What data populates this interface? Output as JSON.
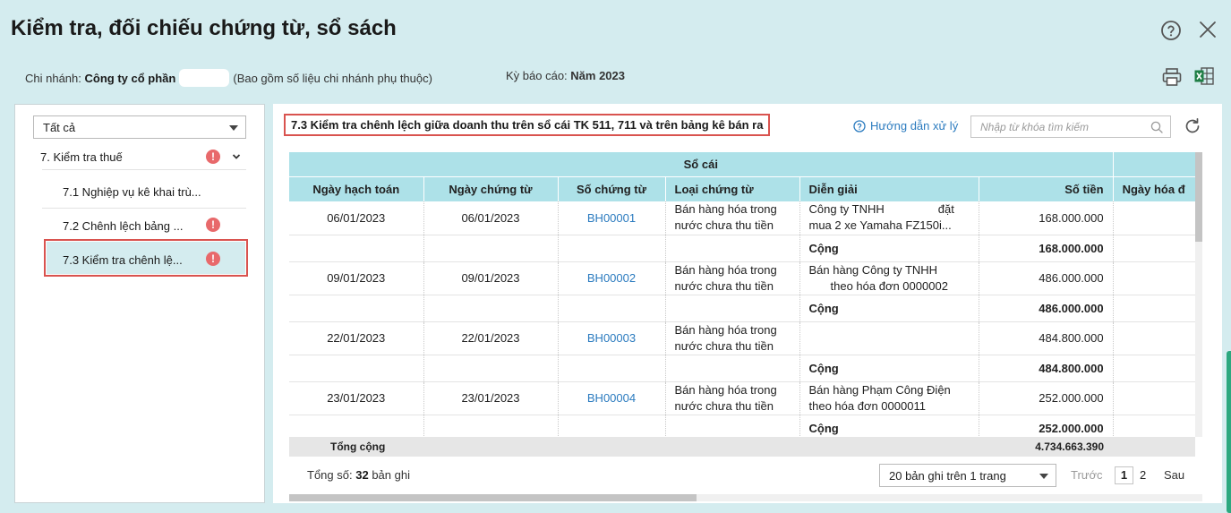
{
  "window": {
    "title": "Kiểm tra, đối chiếu chứng từ, sổ sách"
  },
  "info": {
    "branch_label": "Chi nhánh:",
    "branch_value": "Công ty cổ phần",
    "branch_note": "(Bao gồm số liệu chi nhánh phụ thuộc)",
    "period_label": "Kỳ báo cáo:",
    "period_value": "Năm 2023"
  },
  "sidebar": {
    "filter_value": "Tất cả",
    "root_label": "7. Kiểm tra thuế",
    "alert_glyph": "!",
    "items": [
      {
        "label": "7.1 Nghiệp vụ kê khai trù..."
      },
      {
        "label": "7.2 Chênh lệch bảng ..."
      },
      {
        "label": "7.3 Kiểm tra chênh lệ..."
      }
    ]
  },
  "report": {
    "title": "7.3 Kiểm tra chênh lệch giữa doanh thu trên sổ cái TK 511, 711 và trên bảng kê bán ra",
    "guide_label": "Hướng dẫn xử lý",
    "search_placeholder": "Nhập từ khóa tìm kiếm"
  },
  "table": {
    "group_header": "Sổ cái",
    "headers": [
      "Ngày hạch toán",
      "Ngày chứng từ",
      "Số chứng từ",
      "Loại chứng từ",
      "Diễn giải",
      "Số tiền",
      "Ngày hóa đ"
    ],
    "subtotal_label": "Cộng",
    "rows": [
      {
        "posting_date": "06/01/2023",
        "doc_date": "06/01/2023",
        "doc_no": "BH00001",
        "doc_type_1": "Bán hàng hóa trong",
        "doc_type_2": "nước chưa thu tiền",
        "desc_1a": "Công ty TNHH",
        "desc_1b": "đặt",
        "desc_2": "mua 2 xe Yamaha FZ150i...",
        "amount": "168.000.000",
        "subtotal": "168.000.000"
      },
      {
        "posting_date": "09/01/2023",
        "doc_date": "09/01/2023",
        "doc_no": "BH00002",
        "doc_type_1": "Bán hàng hóa trong",
        "doc_type_2": "nước chưa thu tiền",
        "desc_1a": "Bán hàng Công ty TNHH",
        "desc_2": "theo hóa đơn 0000002",
        "amount": "486.000.000",
        "subtotal": "486.000.000"
      },
      {
        "posting_date": "22/01/2023",
        "doc_date": "22/01/2023",
        "doc_no": "BH00003",
        "doc_type_1": "Bán hàng hóa trong",
        "doc_type_2": "nước chưa thu tiền",
        "desc_1a": "",
        "desc_2": "",
        "amount": "484.800.000",
        "subtotal": "484.800.000"
      },
      {
        "posting_date": "23/01/2023",
        "doc_date": "23/01/2023",
        "doc_no": "BH00004",
        "doc_type_1": "Bán hàng hóa trong",
        "doc_type_2": "nước chưa thu tiền",
        "desc_1a": "Bán hàng Phạm Công Điện",
        "desc_2": "theo hóa đơn 0000011",
        "amount": "252.000.000",
        "subtotal": "252.000.000"
      }
    ],
    "total_label": "Tổng cộng",
    "total_value": "4.734.663.390"
  },
  "footer": {
    "count_prefix": "Tổng số:",
    "count_value": "32",
    "count_suffix": "bản ghi",
    "page_size": "20 bản ghi trên 1 trang",
    "prev": "Trước",
    "page_1": "1",
    "page_2": "2",
    "next": "Sau"
  },
  "colors": {
    "accent": "#2b7bbf",
    "header_bg": "#ade1e8",
    "alert": "#e8696b",
    "highlight": "#d9534f",
    "background": "#d4ecef"
  }
}
